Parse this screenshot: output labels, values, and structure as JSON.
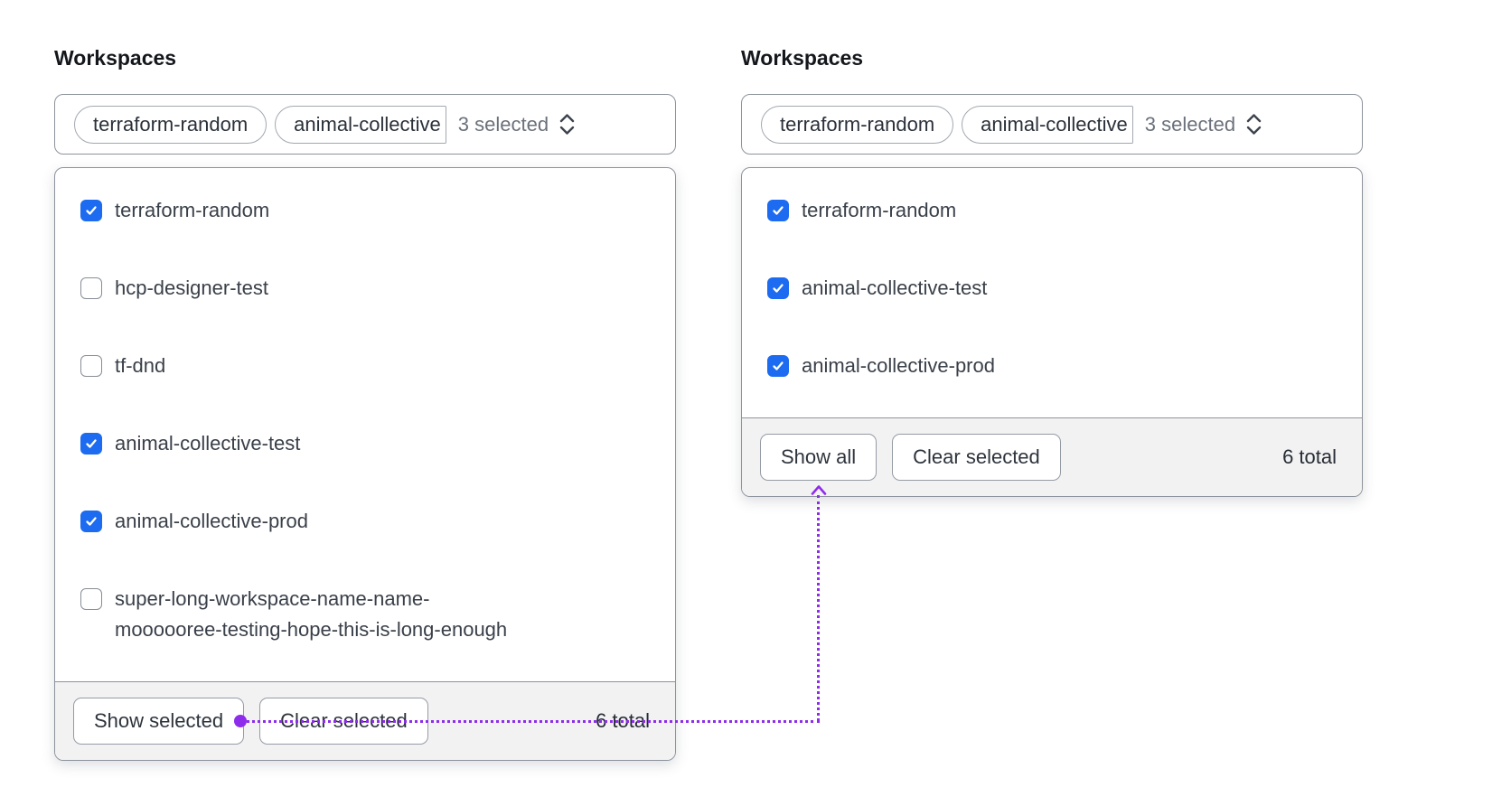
{
  "colors": {
    "accent_blue": "#1c6bf0",
    "annotation_purple": "#8e2ceb",
    "footer_bg": "#f2f2f3",
    "box_border": "#8d939c"
  },
  "icons": {
    "expand": "unfold-more-icon",
    "checked": "checkmark-icon",
    "connector_arrow": "arrow-up-icon",
    "connector_start": "dot"
  },
  "panels": {
    "left": {
      "label": "Workspaces",
      "toggle": {
        "tags": [
          "terraform-random",
          "animal-collective"
        ],
        "summary": "3 selected"
      },
      "options": [
        {
          "label": "terraform-random",
          "checked": true
        },
        {
          "label": "hcp-designer-test",
          "checked": false
        },
        {
          "label": "tf-dnd",
          "checked": false
        },
        {
          "label": "animal-collective-test",
          "checked": true
        },
        {
          "label": "animal-collective-prod",
          "checked": true
        },
        {
          "label": "super-long-workspace-name-name-",
          "label_line2": "moooooree-testing-hope-this-is-long-enough",
          "checked": false
        }
      ],
      "footer": {
        "show_button": "Show selected",
        "clear_button": "Clear selected",
        "total": "6 total"
      }
    },
    "right": {
      "label": "Workspaces",
      "toggle": {
        "tags": [
          "terraform-random",
          "animal-collective"
        ],
        "summary": "3 selected"
      },
      "options": [
        {
          "label": "terraform-random",
          "checked": true
        },
        {
          "label": "animal-collective-test",
          "checked": true
        },
        {
          "label": "animal-collective-prod",
          "checked": true
        }
      ],
      "footer": {
        "show_button": "Show all",
        "clear_button": "Clear selected",
        "total": "6 total"
      }
    }
  }
}
